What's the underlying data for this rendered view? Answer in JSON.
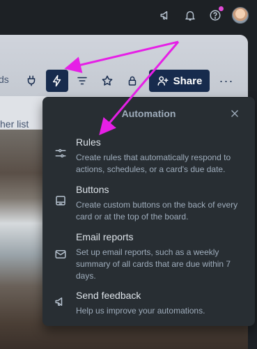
{
  "topbar": {
    "icons": [
      "megaphone-icon",
      "bell-icon",
      "help-icon"
    ],
    "notification_color": "#e14ad6"
  },
  "board": {
    "header_text_cut": "ds",
    "tab_text_cut": "her list",
    "share_label": "Share",
    "more_label": "···",
    "accent": "#172b4d"
  },
  "automation": {
    "title": "Automation",
    "items": [
      {
        "icon": "rules-sliders-icon",
        "title": "Rules",
        "desc": "Create rules that automatically respond to actions, schedules, or a card's due date."
      },
      {
        "icon": "buttons-card-icon",
        "title": "Buttons",
        "desc": "Create custom buttons on the back of every card or at the top of the board."
      },
      {
        "icon": "mail-icon",
        "title": "Email reports",
        "desc": "Set up email reports, such as a weekly summary of all cards that are due within 7 days."
      },
      {
        "icon": "megaphone-icon",
        "title": "Send feedback",
        "desc": "Help us improve your automations."
      }
    ]
  },
  "annotation": {
    "arrow_color": "#e61fe6"
  }
}
